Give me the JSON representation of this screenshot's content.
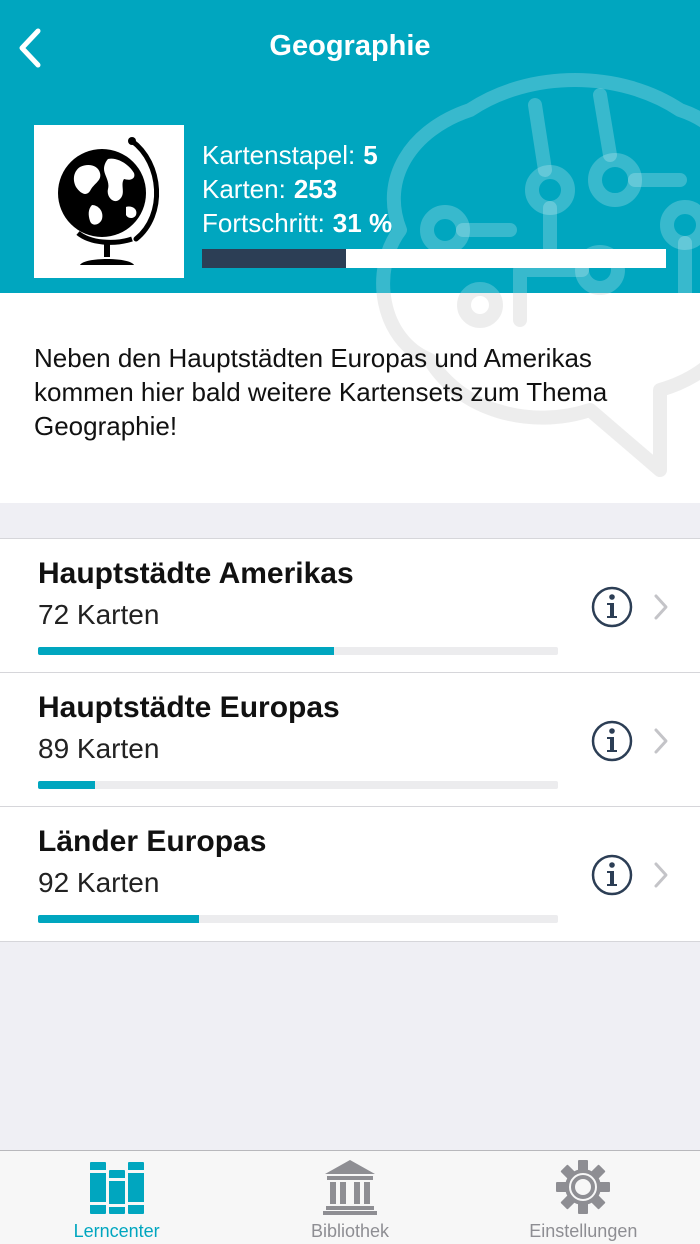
{
  "header": {
    "title": "Geographie",
    "back_icon": "chevron-left-icon"
  },
  "deck_image": {
    "icon": "globe-icon"
  },
  "stats": {
    "kartenstapel_label": "Kartenstapel:",
    "kartenstapel_value": "5",
    "karten_label": "Karten:",
    "karten_value": "253",
    "fortschritt_label": "Fortschritt:",
    "fortschritt_value": "31 %",
    "progress_fraction": 0.31
  },
  "description": "Neben den Hauptstädten Europas und Amerikas kommen hier bald weitere Kartensets zum Thema Geographie!",
  "decks": [
    {
      "name": "Hauptstädte Amerikas",
      "count": "72 Karten",
      "progress": 0.57
    },
    {
      "name": "Hauptstädte Europas",
      "count": "89 Karten",
      "progress": 0.11
    },
    {
      "name": "Länder Europas",
      "count": "92 Karten",
      "progress": 0.31
    }
  ],
  "tabbar": {
    "tabs": [
      {
        "label": "Lerncenter",
        "icon": "books-icon",
        "active": true
      },
      {
        "label": "Bibliothek",
        "icon": "library-icon",
        "active": false
      },
      {
        "label": "Einstellungen",
        "icon": "gear-icon",
        "active": false
      }
    ]
  },
  "colors": {
    "brand": "#00a6bf",
    "progress_dark": "#2c3e55",
    "inactive_tab": "#8e8e93"
  }
}
